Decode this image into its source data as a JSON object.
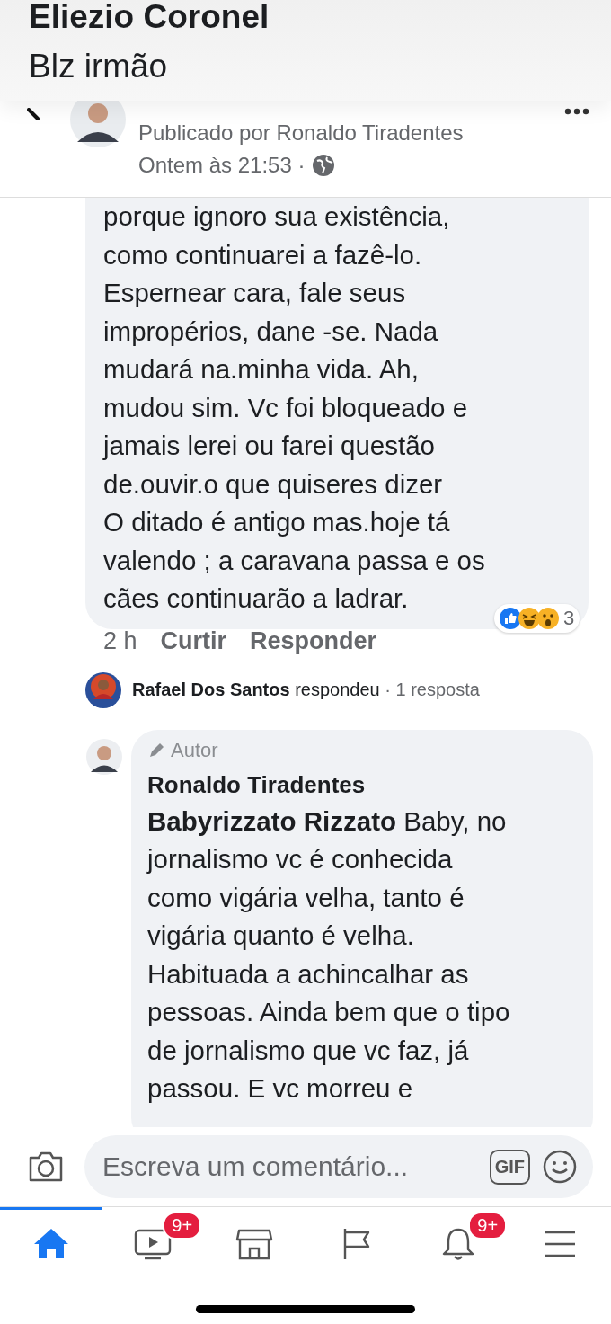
{
  "notification": {
    "sender": "Eliezio Coronel",
    "message": "Blz irmão"
  },
  "post_header": {
    "author_line": "Publicado por Ronaldo Tiradentes",
    "time": "Ontem às 21:53 ·"
  },
  "comment": {
    "lines": [
      "porque ignoro sua existência,",
      "como continuarei a fazê-lo.",
      "Espernear cara, fale seus",
      "impropérios, dane -se. Nada",
      "mudará na.minha vida. Ah,",
      "mudou sim. Vc foi bloqueado e",
      "jamais lerei ou farei questão",
      "de.ouvir.o que quiseres dizer",
      "O ditado é antigo mas.hoje tá",
      "valendo ; a caravana passa e os",
      "cães continuarão a ladrar."
    ],
    "time": "2 h",
    "actions": [
      "Curtir",
      "Responder"
    ],
    "reactions": [
      {
        "kind": "like"
      },
      {
        "kind": "haha"
      },
      {
        "kind": "wow"
      }
    ],
    "reaction_count": "3"
  },
  "reply_summary": {
    "name": "Rafael Dos Santos",
    "verb": "respondeu",
    "count": "· 1 resposta"
  },
  "reply": {
    "badge": "Autor",
    "name": "Ronaldo Tiradentes",
    "lines": [
      "**Babyrizzato Rizzato** Baby, no",
      "jornalismo vc é conhecida",
      "como vigária velha, tanto é",
      "vigária quanto é velha.",
      "Habituada a achincalhar as",
      "pessoas. Ainda bem que o tipo",
      "de jornalismo que vc faz, já",
      "passou. E vc morreu e"
    ]
  },
  "composer": {
    "placeholder": "Escreva um comentário...",
    "gif": "GIF"
  },
  "tabs": [
    {
      "kind": "home",
      "selected": true
    },
    {
      "kind": "video",
      "selected": false,
      "badge": "9+"
    },
    {
      "kind": "marketplace",
      "selected": false
    },
    {
      "kind": "pages",
      "selected": false
    },
    {
      "kind": "notifications",
      "selected": false,
      "badge": "9+"
    },
    {
      "kind": "menu",
      "selected": false
    }
  ]
}
